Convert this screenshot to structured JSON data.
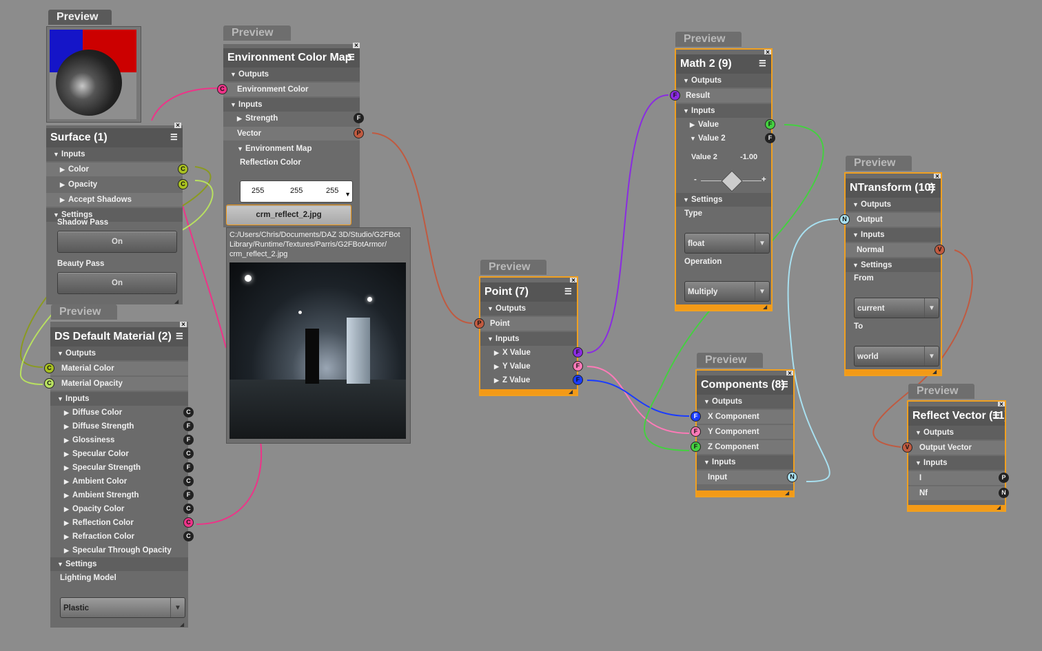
{
  "preview_tab": "Preview",
  "surface": {
    "title": "Surface (1)",
    "inputs": "Inputs",
    "items": [
      "Color",
      "Opacity",
      "Accept Shadows"
    ],
    "ports": [
      "C",
      "C"
    ],
    "settings": "Settings",
    "shadow_pass": "Shadow Pass",
    "shadow_value": "On",
    "beauty_pass": "Beauty Pass",
    "beauty_value": "On"
  },
  "env": {
    "title": "Environment Color Map",
    "outputs": "Outputs",
    "out_item": "Environment Color",
    "out_port": "C",
    "inputs": "Inputs",
    "strength": "Strength",
    "strength_port": "F",
    "vector": "Vector",
    "vector_port": "P",
    "env_map": "Environment Map",
    "refl_color": "Reflection Color",
    "rgb": [
      "255",
      "255",
      "255"
    ],
    "file_button": "crm_reflect_2.jpg",
    "path_1": "C:/Users/Chris/Documents/DAZ 3D/Studio/G2FBot",
    "path_2": "Library/Runtime/Textures/Parris/G2FBotArmor/",
    "path_3": "crm_reflect_2.jpg"
  },
  "dsm": {
    "title": "DS Default Material (2)",
    "outputs": "Outputs",
    "out_items": [
      "Material Color",
      "Material Opacity"
    ],
    "out_ports": [
      "C",
      "C"
    ],
    "inputs": "Inputs",
    "in_items": [
      "Diffuse Color",
      "Diffuse Strength",
      "Glossiness",
      "Specular Color",
      "Specular Strength",
      "Ambient Color",
      "Ambient Strength",
      "Opacity Color",
      "Reflection Color",
      "Refraction Color",
      "Specular Through Opacity"
    ],
    "in_ports": [
      "C",
      "F",
      "F",
      "C",
      "F",
      "C",
      "F",
      "C",
      "C",
      "C",
      ""
    ],
    "settings": "Settings",
    "lighting": "Lighting Model",
    "lighting_value": "Plastic"
  },
  "point": {
    "title": "Point (7)",
    "outputs": "Outputs",
    "out_item": "Point",
    "out_port": "P",
    "inputs": "Inputs",
    "in_items": [
      "X Value",
      "Y Value",
      "Z Value"
    ],
    "in_ports": [
      "F",
      "F",
      "F"
    ]
  },
  "math": {
    "title": "Math 2 (9)",
    "outputs": "Outputs",
    "result": "Result",
    "result_port": "F",
    "inputs": "Inputs",
    "value": "Value",
    "value2": "Value 2",
    "port_f": "F",
    "value2_label": "Value 2",
    "value2_num": "-1.00",
    "minus": "-",
    "plus": "+",
    "settings": "Settings",
    "type": "Type",
    "type_value": "float",
    "operation": "Operation",
    "operation_value": "Multiply"
  },
  "comp": {
    "title": "Components (8)",
    "outputs": "Outputs",
    "out_items": [
      "X Component",
      "Y Component",
      "Z Component"
    ],
    "out_ports": [
      "F",
      "F",
      "F"
    ],
    "inputs": "Inputs",
    "input": "Input",
    "input_port": "N"
  },
  "ntrans": {
    "title": "NTransform (10)",
    "outputs": "Outputs",
    "output": "Output",
    "output_port": "N",
    "inputs": "Inputs",
    "normal": "Normal",
    "normal_port": "V",
    "settings": "Settings",
    "from": "From",
    "from_value": "current",
    "to": "To",
    "to_value": "world"
  },
  "refl": {
    "title": "Reflect Vector (11)",
    "outputs": "Outputs",
    "out_item": "Output Vector",
    "out_port": "V",
    "inputs": "Inputs",
    "in_items": [
      "I",
      "Nf"
    ],
    "in_ports": [
      "P",
      "N"
    ]
  },
  "colors": {
    "background": "#8c8c8c",
    "node": "#6b6b6b",
    "selected": "#f39a17",
    "port_c_yellow": "#a8c020",
    "port_c_pink": "#ee3388",
    "port_f_purple": "#8a2be2",
    "port_f_pink": "#ff7ab8",
    "port_f_blue": "#1a3cff",
    "port_f_green": "#44d040",
    "port_n_cyan": "#a8e0f0",
    "port_p": "#c05a40",
    "port_v": "#c05a40"
  }
}
